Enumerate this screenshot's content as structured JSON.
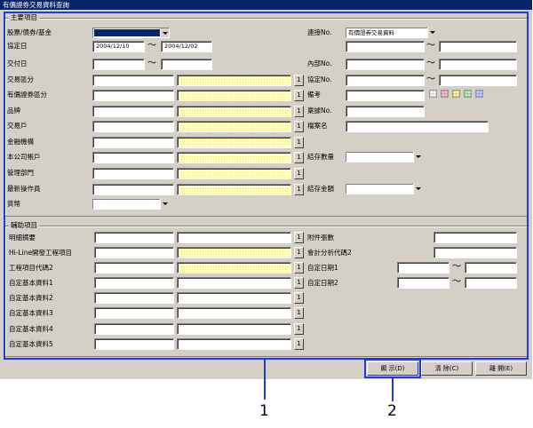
{
  "window": {
    "title": "有價證券交易資料查詢"
  },
  "main_group": {
    "title": "主要項目",
    "row1": {
      "label": "股票/債券/基金",
      "select_value": ""
    },
    "agreement_date": {
      "label": "協定日",
      "from": "2004/12/10",
      "to": "2004/12/02"
    },
    "delivery_date": {
      "label": "交付日",
      "from": "",
      "to": ""
    },
    "lookup_rows": [
      {
        "label": "交易區分",
        "btn": "1"
      },
      {
        "label": "有價證券區分",
        "btn": "1"
      },
      {
        "label": "品牌",
        "btn": "1"
      },
      {
        "label": "交易戶",
        "btn": "1"
      },
      {
        "label": "金融機構",
        "btn": "1"
      },
      {
        "label": "本公司帳戶",
        "btn": "1"
      },
      {
        "label": "管理部門",
        "btn": "1"
      },
      {
        "label": "最新操作員",
        "btn": "1"
      }
    ],
    "currency": {
      "label": "貨幣",
      "value": ""
    },
    "right": {
      "link_no": {
        "label": "連接No.",
        "value": "有價證券交易資料"
      },
      "internal_no": {
        "label": "內部No."
      },
      "agreement_no": {
        "label": "協定No."
      },
      "remarks": {
        "label": "備考"
      },
      "audit_no": {
        "label": "稟據No."
      },
      "file_name": {
        "label": "檔案名"
      },
      "stock_qty": {
        "label": "結存數量",
        "value": ""
      },
      "stock_amount": {
        "label": "結存金額",
        "value": ""
      }
    }
  },
  "aux_group": {
    "title": "輔助項目",
    "rows": [
      {
        "label": "明細摘要",
        "btn": "1"
      },
      {
        "label": "Hi-Line開發工程項目",
        "btn": "1"
      },
      {
        "label": "工程項目代碼2",
        "btn": "1"
      },
      {
        "label": "自定基本資料1",
        "btn": "1"
      },
      {
        "label": "自定基本資料2",
        "btn": "1"
      },
      {
        "label": "自定基本資料3",
        "btn": "1"
      },
      {
        "label": "自定基本資料4",
        "btn": "1"
      },
      {
        "label": "自定基本資料5",
        "btn": "1"
      }
    ],
    "right": {
      "attachments": {
        "label": "附件張數"
      },
      "account_code": {
        "label": "會計分析代碼2"
      },
      "custom_date1": {
        "label": "自定日期1"
      },
      "custom_date2": {
        "label": "自定日期2"
      }
    }
  },
  "buttons": {
    "display": "顯 示(D)",
    "clear": "清 除(C)",
    "leave": "離 開(E)"
  },
  "tilde": "～",
  "callouts": {
    "one": "1",
    "two": "2"
  },
  "colors": {
    "accent": "#1c3cdc",
    "titlebar": "#0a246a",
    "lookup_field": "#ffffc0"
  }
}
